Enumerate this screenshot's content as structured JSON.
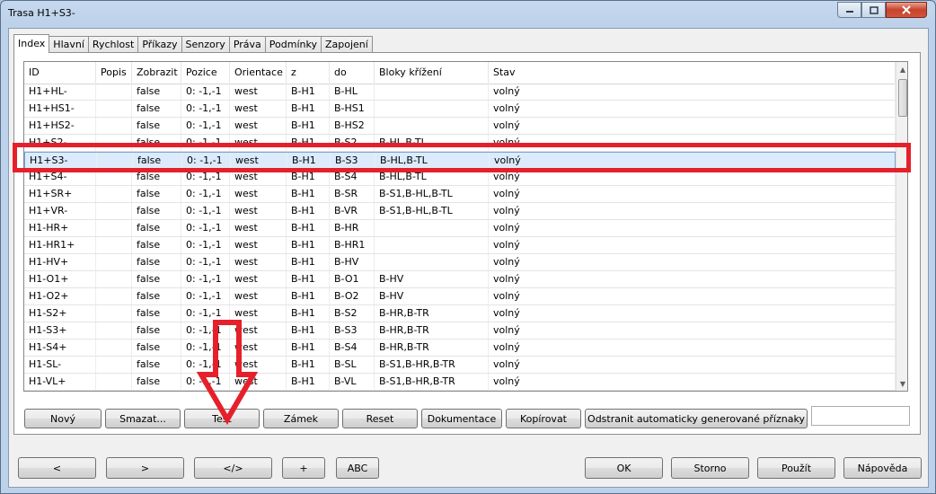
{
  "window": {
    "title": "Trasa H1+S3-"
  },
  "tabs": [
    "Index",
    "Hlavní",
    "Rychlost",
    "Příkazy",
    "Senzory",
    "Práva",
    "Podmínky",
    "Zapojení"
  ],
  "table": {
    "columns": [
      "ID",
      "Popis",
      "Zobrazit",
      "Pozice",
      "Orientace",
      "z",
      "do",
      "Bloky křížení",
      "Stav"
    ],
    "rows": [
      [
        "H1+HL-",
        "",
        "false",
        "0: -1,-1",
        "west",
        "B-H1",
        "B-HL",
        "",
        "volný"
      ],
      [
        "H1+HS1-",
        "",
        "false",
        "0: -1,-1",
        "west",
        "B-H1",
        "B-HS1",
        "",
        "volný"
      ],
      [
        "H1+HS2-",
        "",
        "false",
        "0: -1,-1",
        "west",
        "B-H1",
        "B-HS2",
        "",
        "volný"
      ],
      [
        "H1+S2-",
        "",
        "false",
        "0: -1,-1",
        "west",
        "B-H1",
        "B-S2",
        "B-HL,B-TL",
        "volný"
      ],
      [
        "H1+S3-",
        "",
        "false",
        "0: -1,-1",
        "west",
        "B-H1",
        "B-S3",
        "B-HL,B-TL",
        "volný"
      ],
      [
        "H1+S4-",
        "",
        "false",
        "0: -1,-1",
        "west",
        "B-H1",
        "B-S4",
        "B-HL,B-TL",
        "volný"
      ],
      [
        "H1+SR+",
        "",
        "false",
        "0: -1,-1",
        "west",
        "B-H1",
        "B-SR",
        "B-S1,B-HL,B-TL",
        "volný"
      ],
      [
        "H1+VR-",
        "",
        "false",
        "0: -1,-1",
        "west",
        "B-H1",
        "B-VR",
        "B-S1,B-HL,B-TL",
        "volný"
      ],
      [
        "H1-HR+",
        "",
        "false",
        "0: -1,-1",
        "west",
        "B-H1",
        "B-HR",
        "",
        "volný"
      ],
      [
        "H1-HR1+",
        "",
        "false",
        "0: -1,-1",
        "west",
        "B-H1",
        "B-HR1",
        "",
        "volný"
      ],
      [
        "H1-HV+",
        "",
        "false",
        "0: -1,-1",
        "west",
        "B-H1",
        "B-HV",
        "",
        "volný"
      ],
      [
        "H1-O1+",
        "",
        "false",
        "0: -1,-1",
        "west",
        "B-H1",
        "B-O1",
        "B-HV",
        "volný"
      ],
      [
        "H1-O2+",
        "",
        "false",
        "0: -1,-1",
        "west",
        "B-H1",
        "B-O2",
        "B-HV",
        "volný"
      ],
      [
        "H1-S2+",
        "",
        "false",
        "0: -1,-1",
        "west",
        "B-H1",
        "B-S2",
        "B-HR,B-TR",
        "volný"
      ],
      [
        "H1-S3+",
        "",
        "false",
        "0: -1,-1",
        "west",
        "B-H1",
        "B-S3",
        "B-HR,B-TR",
        "volný"
      ],
      [
        "H1-S4+",
        "",
        "false",
        "0: -1,-1",
        "west",
        "B-H1",
        "B-S4",
        "B-HR,B-TR",
        "volný"
      ],
      [
        "H1-SL-",
        "",
        "false",
        "0: -1,-1",
        "west",
        "B-H1",
        "B-SL",
        "B-S1,B-HR,B-TR",
        "volný"
      ],
      [
        "H1-VL+",
        "",
        "false",
        "0: -1,-1",
        "west",
        "B-H1",
        "B-VL",
        "B-S1,B-HR,B-TR",
        "volný"
      ]
    ],
    "selected_id": "H1+S3-"
  },
  "actions": {
    "new": "Nový",
    "delete": "Smazat...",
    "test": "Test",
    "lock": "Zámek",
    "reset": "Reset",
    "docs": "Dokumentace",
    "copy": "Kopírovat",
    "remove_auto": "Odstranit automaticky generované příznaky"
  },
  "bottom": {
    "prev": "<",
    "next": ">",
    "code": "</>",
    "plus": "+",
    "abc": "ABC",
    "ok": "OK",
    "cancel": "Storno",
    "apply": "Použít",
    "help": "Nápověda"
  },
  "colors": {
    "annotation": "#e6202a",
    "selection": "#dcebfc"
  }
}
